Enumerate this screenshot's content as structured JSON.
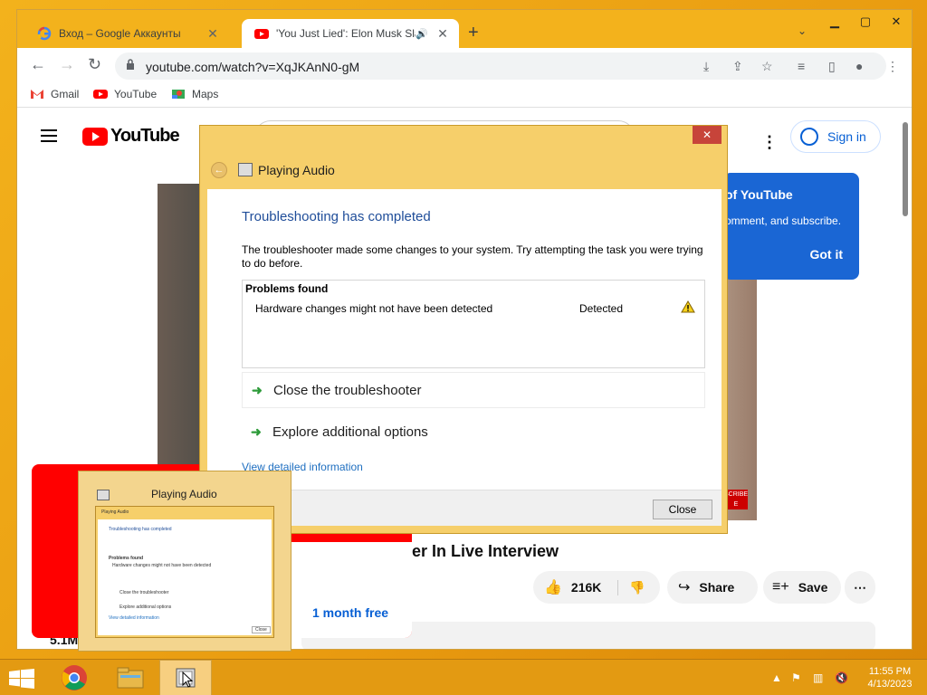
{
  "browser": {
    "tabs": [
      {
        "title": "Вход – Google Аккаунты",
        "active": false
      },
      {
        "title": "'You Just Lied': Elon Musk Sla",
        "active": true
      }
    ],
    "url": "youtube.com/watch?v=XqJKAnN0-gM",
    "bookmarks": [
      {
        "label": "Gmail"
      },
      {
        "label": "YouTube"
      },
      {
        "label": "Maps"
      }
    ]
  },
  "youtube": {
    "logo_text": "YouTube",
    "sign_in": "Sign in",
    "tooltip": {
      "title": "of YouTube",
      "text": "omment, and subscribe.",
      "button": "Got it"
    },
    "video_title": "er In Live Interview",
    "likes": "216K",
    "share": "Share",
    "save": "Save",
    "views": "5.1M",
    "ad_offer": "1 month free",
    "subscribe_tag": "SCRIBE E"
  },
  "dialog": {
    "title": "Playing Audio",
    "heading": "Troubleshooting has completed",
    "message": "The troubleshooter made some changes to your system. Try attempting the task you were trying to do before.",
    "problems_header": "Problems found",
    "problems": [
      {
        "name": "Hardware changes might not have been detected",
        "status": "Detected"
      }
    ],
    "options": [
      {
        "label": "Close the troubleshooter"
      },
      {
        "label": "Explore additional options"
      }
    ],
    "detail_link": "View detailed information",
    "close_button": "Close"
  },
  "preview": {
    "title": "Playing Audio"
  },
  "taskbar": {
    "time": "11:55 PM",
    "date": "4/13/2023"
  },
  "colors": {
    "desktop": "#f3b21c",
    "youtube_red": "#ff0000",
    "link_blue": "#065fd4",
    "dialog_heading": "#1f4d99"
  }
}
